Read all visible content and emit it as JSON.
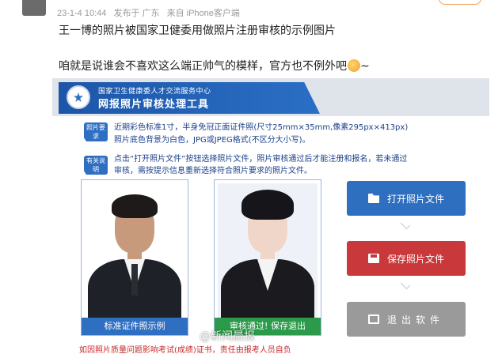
{
  "post": {
    "date": "23-1-4 10:44",
    "published_in": "发布于 广东",
    "source": "来自 iPhone客户端",
    "text_line1": "王一博的照片被国家卫健委用做照片注册审核的示例图片",
    "text_line2": "咱就是说谁会不喜欢这么端正帅气的模样，官方也不例外吧",
    "text_suffix": "~"
  },
  "screenshot": {
    "org_name": "国家卫生健康委人才交流服务中心",
    "tool_name": "网报照片审核处理工具",
    "badges": [
      "照片要求",
      "有关说明"
    ],
    "requirements": [
      "近期彩色标准1寸，半身免冠正面证件照(尺寸25mm×35mm,像素295px×413px)",
      "照片底色背景为白色，JPG或JPEG格式(不区分大小写)。",
      "点击“打开照片文件”按钮选择照片文件，照片审核通过后才能注册和报名，若未通过",
      "审核，需按提示信息重新选择符合照片要求的照片文件。"
    ],
    "sample_caption": "标准证件照示例",
    "result_caption": "审核通过! 保存退出",
    "buttons": {
      "open": "打开照片文件",
      "save": "保存照片文件",
      "exit": "退出软件"
    },
    "warning": "如因照片质量问题影响考试(成绩)证书，责任由报考人员自负",
    "watermark": "@新闻晨报"
  },
  "colors": {
    "brand_blue": "#2f6fc0",
    "save_red": "#c9393b",
    "exit_gray": "#9a9a9a",
    "pass_green": "#2b9a4a"
  },
  "icons": [
    "folder-icon",
    "save-icon",
    "exit-icon",
    "chevron-down-icon"
  ]
}
